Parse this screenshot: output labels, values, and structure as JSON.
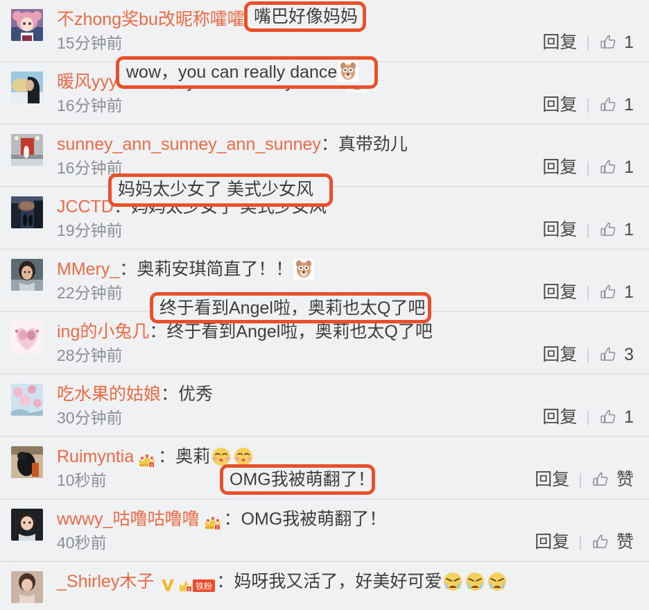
{
  "page": {
    "background_color": "#f0f1f3",
    "divider_color": "#e1e2e4",
    "username_color": "#eb6a46",
    "text_color": "#3d3d3d",
    "timestamp_color": "#8a8f94",
    "highlight_color": "#e8502a"
  },
  "actions": {
    "reply_label": "回复",
    "separator": "|",
    "like_icon": "thumbs-up-icon",
    "like_default_label": "赞"
  },
  "comments": [
    {
      "username": "不zhong奖bu改昵称嚯嚯",
      "colon": "：",
      "text": "嘴巴好像妈妈",
      "timestamp": "15分钟前",
      "reply_label": "回复",
      "like_count": "1",
      "highlighted": true,
      "badges": [],
      "emojis": []
    },
    {
      "username": "暖风yyy",
      "colon": "：",
      "text": "wow，you can really dance",
      "timestamp": "16分钟前",
      "reply_label": "回复",
      "like_count": "1",
      "highlighted": true,
      "badges": [],
      "emojis": [
        "doge-emoji"
      ]
    },
    {
      "username": "sunney_ann_sunney_ann_sunney",
      "colon": "：",
      "text": "真带劲儿",
      "timestamp": "16分钟前",
      "reply_label": "回复",
      "like_count": "1",
      "highlighted": false,
      "badges": [],
      "emojis": []
    },
    {
      "username": "JCCTD",
      "colon": "：",
      "text": "妈妈太少女了 美式少女风",
      "timestamp": "19分钟前",
      "reply_label": "回复",
      "like_count": "1",
      "highlighted": true,
      "badges": [],
      "emojis": []
    },
    {
      "username": "MMery_",
      "colon": "：",
      "text": "奥莉安琪简直了！！",
      "timestamp": "22分钟前",
      "reply_label": "回复",
      "like_count": "1",
      "highlighted": false,
      "badges": [],
      "emojis": [
        "doge-emoji"
      ]
    },
    {
      "username": "ing的小兔几",
      "colon": "：",
      "text": "终于看到Angel啦，奥莉也太Q了吧",
      "timestamp": "28分钟前",
      "reply_label": "回复",
      "like_count": "3",
      "highlighted": true,
      "badges": [],
      "emojis": []
    },
    {
      "username": "吃水果的姑娘",
      "colon": "：",
      "text": "优秀",
      "timestamp": "30分钟前",
      "reply_label": "回复",
      "like_count": "1",
      "highlighted": false,
      "badges": [],
      "emojis": []
    },
    {
      "username": "Ruimyntia",
      "colon": "：",
      "text": "奥莉",
      "timestamp": "10秒前",
      "reply_label": "回复",
      "like_count": "赞",
      "highlighted": false,
      "badges": [
        "crown-level-badge"
      ],
      "emojis": [
        "kissing-face-emoji",
        "kissing-face-emoji"
      ]
    },
    {
      "username": "wwwy_咕噜咕噜噜",
      "colon": "：",
      "text": "OMG我被萌翻了！",
      "timestamp": "40秒前",
      "reply_label": "回复",
      "like_count": "赞",
      "highlighted": true,
      "badges": [
        "crown-level-badge"
      ],
      "emojis": []
    },
    {
      "username": "_Shirley木子",
      "colon": "：",
      "text": "妈呀我又活了，好美好可爱",
      "timestamp": "",
      "reply_label": "",
      "like_count": "",
      "highlighted": false,
      "badges": [
        "verified-v-badge",
        "crown-fan-badge"
      ],
      "badge_fan_label": "铁粉",
      "emojis": [
        "crying-face-emoji",
        "crying-face-emoji",
        "crying-face-emoji"
      ]
    }
  ]
}
